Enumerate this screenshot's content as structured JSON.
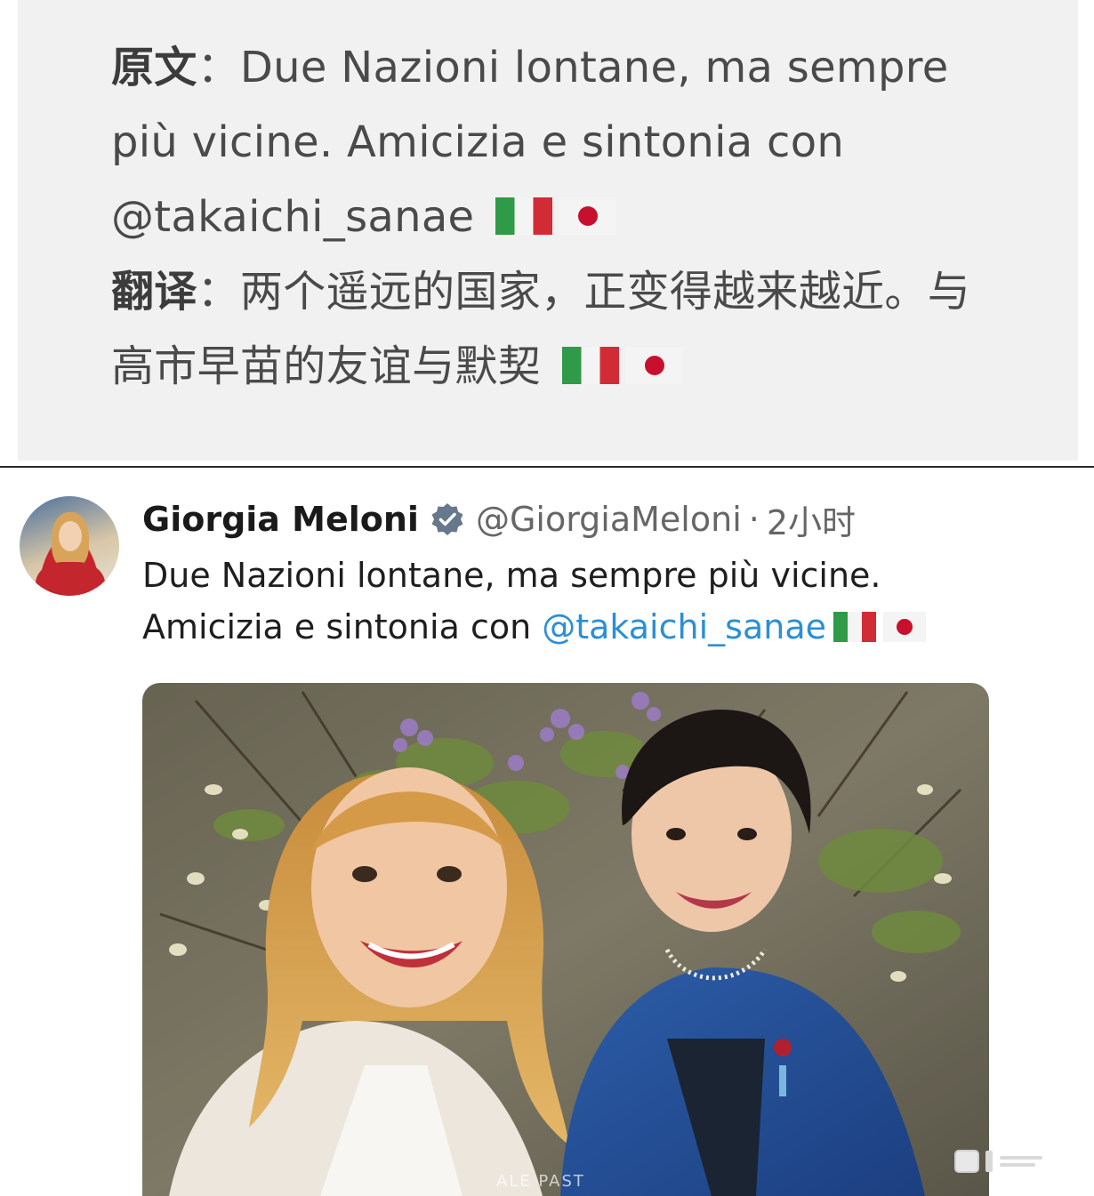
{
  "translation": {
    "original_label": "原文",
    "original_text": "Due Nazioni lontane, ma sempre più vicine. Amicizia e sintonia con @takaichi_sanae",
    "translation_label": "翻译",
    "translation_text": "两个遥远的国家，正变得越来越近。与高市早苗的友谊与默契",
    "colon": "："
  },
  "tweet": {
    "author_name": "Giorgia Meloni",
    "author_handle": "@GiorgiaMeloni",
    "separator": "·",
    "timestamp": "2小时",
    "body_line1": "Due Nazioni lontane, ma sempre più vicine.",
    "body_line2_prefix": "Amicizia e sintonia con ",
    "mention": "@takaichi_sanae",
    "photo_watermark": "ALE PAST"
  },
  "icons": {
    "verified": "verified-badge-icon",
    "flag_italy": "italy-flag-icon",
    "flag_japan": "japan-flag-icon",
    "more": "more-icon"
  },
  "colors": {
    "mention": "#2a8fd6",
    "panel_bg": "#f1f1f1",
    "verified_badge": "#66788a"
  }
}
